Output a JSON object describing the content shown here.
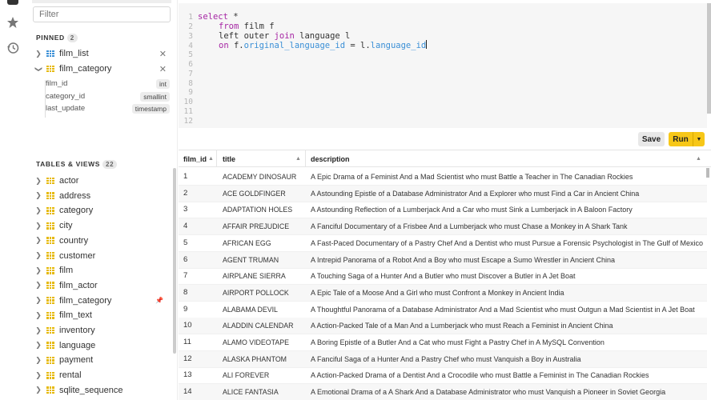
{
  "rail": {
    "icons": [
      "database-icon",
      "star-icon",
      "history-icon"
    ]
  },
  "sidebar": {
    "filter_placeholder": "Filter",
    "pinned_title": "PINNED",
    "pinned_count": "2",
    "pinned": [
      {
        "name": "film_list",
        "icon": "view-icon"
      },
      {
        "name": "film_category",
        "icon": "table-icon",
        "expanded": true,
        "columns": [
          {
            "name": "film_id",
            "type": "int"
          },
          {
            "name": "category_id",
            "type": "smallint"
          },
          {
            "name": "last_update",
            "type": "timestamp"
          }
        ]
      }
    ],
    "tables_title": "TABLES & VIEWS",
    "tables_count": "22",
    "tables": [
      "actor",
      "address",
      "category",
      "city",
      "country",
      "customer",
      "film",
      "film_actor",
      "film_category",
      "film_text",
      "inventory",
      "language",
      "payment",
      "rental",
      "sqlite_sequence"
    ]
  },
  "editor": {
    "line_numbers": [
      "1",
      "2",
      "3",
      "4",
      "5",
      "6",
      "7",
      "8",
      "9",
      "10",
      "11",
      "12"
    ],
    "lines": [
      "select *",
      "from film f",
      "left outer join language l",
      "on f.original_language_id = l.language_id"
    ]
  },
  "toolbar": {
    "save_label": "Save",
    "run_label": "Run"
  },
  "results": {
    "columns": [
      "film_id",
      "title",
      "description"
    ],
    "rows": [
      [
        "1",
        "ACADEMY DINOSAUR",
        "A Epic Drama of a Feminist And a Mad Scientist who must Battle a Teacher in The Canadian Rockies"
      ],
      [
        "2",
        "ACE GOLDFINGER",
        "A Astounding Epistle of a Database Administrator And a Explorer who must Find a Car in Ancient China"
      ],
      [
        "3",
        "ADAPTATION HOLES",
        "A Astounding Reflection of a Lumberjack And a Car who must Sink a Lumberjack in A Baloon Factory"
      ],
      [
        "4",
        "AFFAIR PREJUDICE",
        "A Fanciful Documentary of a Frisbee And a Lumberjack who must Chase a Monkey in A Shark Tank"
      ],
      [
        "5",
        "AFRICAN EGG",
        "A Fast-Paced Documentary of a Pastry Chef And a Dentist who must Pursue a Forensic Psychologist in The Gulf of Mexico"
      ],
      [
        "6",
        "AGENT TRUMAN",
        "A Intrepid Panorama of a Robot And a Boy who must Escape a Sumo Wrestler in Ancient China"
      ],
      [
        "7",
        "AIRPLANE SIERRA",
        "A Touching Saga of a Hunter And a Butler who must Discover a Butler in A Jet Boat"
      ],
      [
        "8",
        "AIRPORT POLLOCK",
        "A Epic Tale of a Moose And a Girl who must Confront a Monkey in Ancient India"
      ],
      [
        "9",
        "ALABAMA DEVIL",
        "A Thoughtful Panorama of a Database Administrator And a Mad Scientist who must Outgun a Mad Scientist in A Jet Boat"
      ],
      [
        "10",
        "ALADDIN CALENDAR",
        "A Action-Packed Tale of a Man And a Lumberjack who must Reach a Feminist in Ancient China"
      ],
      [
        "11",
        "ALAMO VIDEOTAPE",
        "A Boring Epistle of a Butler And a Cat who must Fight a Pastry Chef in A MySQL Convention"
      ],
      [
        "12",
        "ALASKA PHANTOM",
        "A Fanciful Saga of a Hunter And a Pastry Chef who must Vanquish a Boy in Australia"
      ],
      [
        "13",
        "ALI FOREVER",
        "A Action-Packed Drama of a Dentist And a Crocodile who must Battle a Feminist in The Canadian Rockies"
      ],
      [
        "14",
        "ALICE FANTASIA",
        "A Emotional Drama of a A Shark And a Database Administrator who must Vanquish a Pioneer in Soviet Georgia"
      ]
    ]
  },
  "colors": {
    "accent": "#f7c718",
    "keyword": "#a626a4",
    "identifier": "#3a8fd6",
    "table_icon": "#e6b800",
    "view_icon": "#3a8fd6"
  }
}
